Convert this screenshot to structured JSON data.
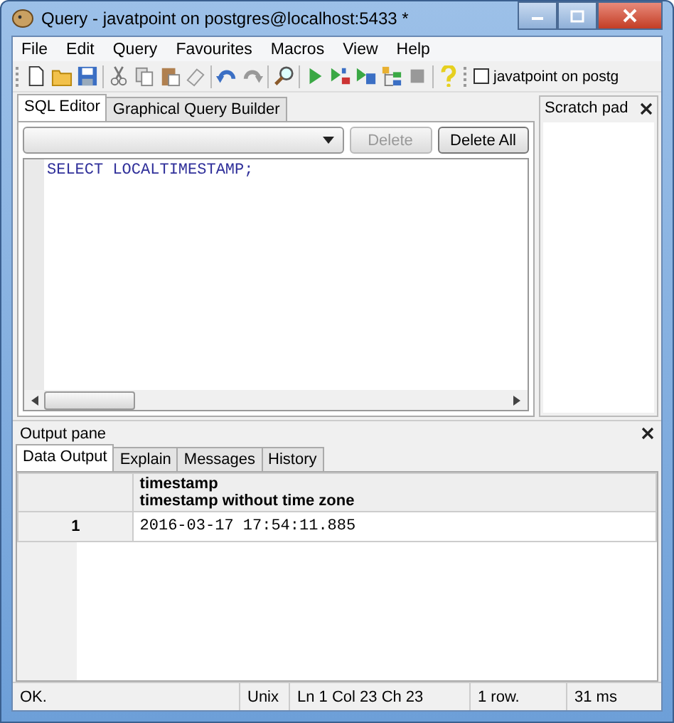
{
  "window": {
    "title": "Query - javatpoint on postgres@localhost:5433 *"
  },
  "menu": [
    "File",
    "Edit",
    "Query",
    "Favourites",
    "Macros",
    "View",
    "Help"
  ],
  "toolbar": [
    {
      "kind": "new"
    },
    {
      "kind": "open"
    },
    {
      "kind": "save"
    },
    {
      "kind": "separator"
    },
    {
      "kind": "cut"
    },
    {
      "kind": "copy"
    },
    {
      "kind": "paste"
    },
    {
      "kind": "clear"
    },
    {
      "kind": "separator"
    },
    {
      "kind": "undo"
    },
    {
      "kind": "redo"
    },
    {
      "kind": "separator"
    },
    {
      "kind": "find"
    },
    {
      "kind": "separator"
    },
    {
      "kind": "execute"
    },
    {
      "kind": "explain"
    },
    {
      "kind": "execute-file"
    },
    {
      "kind": "explain-options"
    },
    {
      "kind": "stop"
    },
    {
      "kind": "separator"
    },
    {
      "kind": "help"
    }
  ],
  "connection": {
    "label": "javatpoint on postg",
    "checked": false
  },
  "editor_tabs": [
    {
      "label": "SQL Editor",
      "selected": true
    },
    {
      "label": "Graphical Query Builder",
      "selected": false
    }
  ],
  "editor_buttons": [
    {
      "label": "Delete",
      "disabled": true
    },
    {
      "label": "Delete All",
      "disabled": false
    }
  ],
  "sql": "SELECT LOCALTIMESTAMP;",
  "scratch_pad": {
    "title": "Scratch pad"
  },
  "output_pane": {
    "title": "Output pane",
    "tabs": [
      {
        "label": "Data Output",
        "selected": true
      },
      {
        "label": "Explain",
        "selected": false
      },
      {
        "label": "Messages",
        "selected": false
      },
      {
        "label": "History",
        "selected": false
      }
    ],
    "columns": [
      {
        "name": "timestamp",
        "type": "timestamp without time zone"
      }
    ],
    "rows": [
      {
        "number": "1",
        "cells": [
          "2016-03-17 17:54:11.885"
        ]
      }
    ]
  },
  "status_bar": [
    "OK.",
    "Unix",
    "Ln 1 Col 23 Ch 23",
    "1 row.",
    "31 ms"
  ]
}
